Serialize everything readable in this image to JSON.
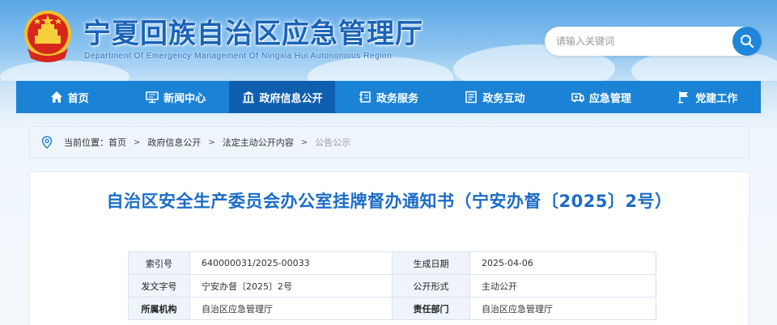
{
  "header": {
    "title": "宁夏回族自治区应急管理厅",
    "subtitle": "Department Of Emergency Management Of Ningxia Hui Autonomous Region",
    "search_placeholder": "请输入关键词"
  },
  "nav": {
    "items": [
      {
        "label": "首页",
        "icon": "home-icon"
      },
      {
        "label": "新闻中心",
        "icon": "monitor-icon"
      },
      {
        "label": "政府信息公开",
        "icon": "government-building-icon",
        "active": true
      },
      {
        "label": "政务服务",
        "icon": "service-icon"
      },
      {
        "label": "政务互动",
        "icon": "document-list-icon"
      },
      {
        "label": "应急管理",
        "icon": "ambulance-icon"
      },
      {
        "label": "党建工作",
        "icon": "flag-icon"
      }
    ]
  },
  "breadcrumb": {
    "prefix": "当前位置：",
    "items": [
      "首页",
      "政府信息公开",
      "法定主动公开内容"
    ],
    "current": "公告公示",
    "separator": ">"
  },
  "article": {
    "title": "自治区安全生产委员会办公室挂牌督办通知书（宁安办督〔2025〕2号）"
  },
  "meta": {
    "rows": [
      {
        "k1": "索引号",
        "v1": "640000031/2025-00033",
        "k2": "生成日期",
        "v2": "2025-04-06",
        "bold": false
      },
      {
        "k1": "发文字号",
        "v1": "宁安办督〔2025〕2号",
        "k2": "公开形式",
        "v2": "主动公开",
        "bold": false
      },
      {
        "k1": "所属机构",
        "v1": "自治区应急管理厅",
        "k2": "责任部门",
        "v2": "自治区应急管理厅",
        "bold": true
      }
    ]
  },
  "colors": {
    "nav_bg": "#1b83d6",
    "nav_active": "#0f5fb0",
    "title_blue": "#1b6cc7"
  }
}
